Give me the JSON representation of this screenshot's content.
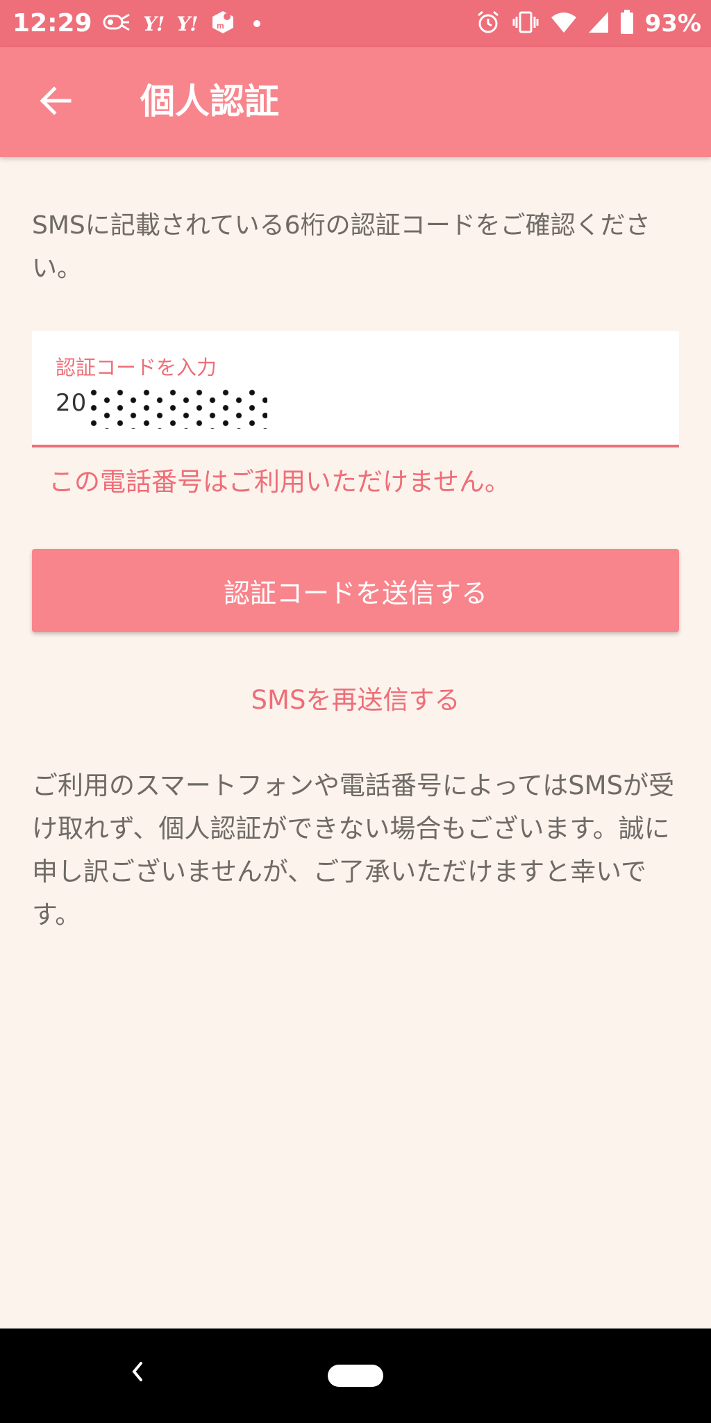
{
  "status_bar": {
    "time": "12:29",
    "battery_percent": "93%",
    "yahoo_icon_1": "Y!",
    "yahoo_icon_2": "Y!",
    "icons": [
      "broadcast-icon",
      "yahoo-icon",
      "yahoo-icon",
      "mercari-icon",
      "notification-dot-icon",
      "alarm-icon",
      "vibrate-icon",
      "wifi-icon",
      "cell-signal-icon",
      "battery-icon"
    ]
  },
  "app_bar": {
    "title": "個人認証",
    "back_icon": "arrow-left-icon"
  },
  "main": {
    "instruction": "SMSに記載されている6桁の認証コードをご確認ください。",
    "code_input": {
      "label": "認証コードを入力",
      "value_visible": "20"
    },
    "error_message": "この電話番号はご利用いただけません。",
    "submit_button_label": "認証コードを送信する",
    "resend_link_label": "SMSを再送信する",
    "notice": "ご利用のスマートフォンや電話番号によってはSMSが受け取れず、個人認証ができない場合もございます。誠に申し訳ございませんが、ご了承いただけますと幸いです。"
  },
  "colors": {
    "status_bar": "#ee6e7a",
    "app_bar": "#f8858c",
    "background": "#fbf3ec",
    "accent": "#ee6e78",
    "body_text": "#6f6a66"
  },
  "nav_bar": {
    "back_icon": "nav-back-icon",
    "home_icon": "nav-home-pill-icon"
  }
}
